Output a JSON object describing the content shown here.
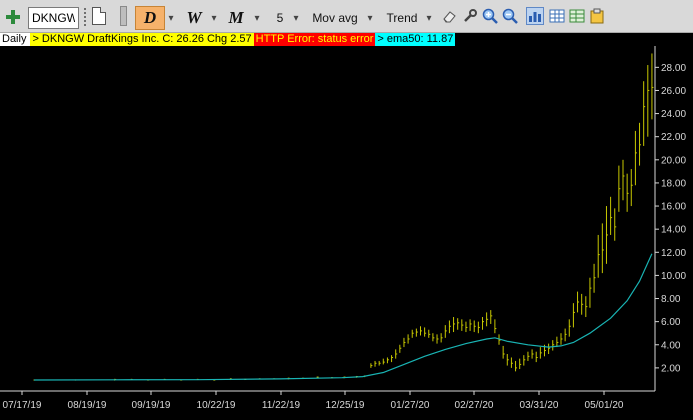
{
  "toolbar": {
    "symbol_value": "DKNGW",
    "period_daily": "D",
    "period_weekly": "W",
    "period_monthly": "M",
    "interval_value": "5",
    "indicator_label": "Mov avg",
    "trend_label": "Trend",
    "dropdown_glyph": "▾"
  },
  "status": {
    "period": "Daily",
    "quote": "> DKNGW  DraftKings Inc.  C: 26.26  Chg 2.57",
    "error": "HTTP Error: status error",
    "ema": "> ema50: 11.87"
  },
  "colors": {
    "background": "#000000",
    "bars": "#c8c800",
    "ema_line": "#19b4b4",
    "axis": "#d8d8d8"
  },
  "chart_data": {
    "type": "line",
    "x_tick_labels": [
      "07/17/19",
      "08/19/19",
      "09/19/19",
      "10/22/19",
      "11/22/19",
      "12/25/19",
      "01/27/20",
      "02/27/20",
      "03/31/20",
      "05/01/20"
    ],
    "y_tick_labels": [
      "2.00",
      "4.00",
      "6.00",
      "8.00",
      "10.00",
      "12.00",
      "14.00",
      "16.00",
      "18.00",
      "20.00",
      "22.00",
      "24.00",
      "26.00",
      "28.00"
    ],
    "ylim": [
      0,
      29.5
    ],
    "series": [
      {
        "type": "bar",
        "values": [
          [
            1,
            0.9,
            1,
            0.95
          ],
          [
            21,
            0.9,
            1,
            0.95
          ],
          [
            40,
            0.9,
            1.05,
            1
          ],
          [
            48,
            0.95,
            1.05,
            1
          ],
          [
            56,
            0.9,
            1,
            0.95
          ],
          [
            64,
            0.95,
            1.05,
            1
          ],
          [
            72,
            0.9,
            1,
            0.95
          ],
          [
            80,
            0.95,
            1.05,
            1
          ],
          [
            88,
            0.9,
            1,
            0.95
          ],
          [
            96,
            0.95,
            1.1,
            1.05
          ],
          [
            103,
            0.95,
            1.05,
            1
          ],
          [
            110,
            1,
            1.1,
            1.05
          ],
          [
            117,
            1,
            1.1,
            1.05
          ],
          [
            124,
            1,
            1.15,
            1.1
          ],
          [
            131,
            1.05,
            1.15,
            1.1
          ],
          [
            138,
            1.1,
            1.25,
            1.2
          ],
          [
            145,
            1.1,
            1.2,
            1.15
          ],
          [
            151,
            1.1,
            1.25,
            1.2
          ],
          [
            157,
            1.15,
            1.3,
            1.25
          ],
          [
            161,
            1.2,
            1.35,
            1.3
          ],
          [
            164,
            2.0,
            2.4,
            2.2
          ],
          [
            166,
            2.1,
            2.6,
            2.4
          ],
          [
            168,
            2.2,
            2.6,
            2.4
          ],
          [
            170,
            2.3,
            2.8,
            2.5
          ],
          [
            172,
            2.4,
            2.9,
            2.7
          ],
          [
            174,
            2.5,
            3.1,
            2.9
          ],
          [
            176,
            2.8,
            3.6,
            3.2
          ],
          [
            178,
            3.3,
            4.0,
            3.7
          ],
          [
            180,
            3.8,
            4.6,
            4.2
          ],
          [
            182,
            4.1,
            4.9,
            4.5
          ],
          [
            184,
            4.6,
            5.3,
            5.0
          ],
          [
            186,
            4.7,
            5.4,
            5.1
          ],
          [
            188,
            4.8,
            5.6,
            5.2
          ],
          [
            190,
            4.7,
            5.5,
            5.0
          ],
          [
            192,
            4.6,
            5.3,
            4.9
          ],
          [
            194,
            4.3,
            5.0,
            4.6
          ],
          [
            196,
            4.1,
            4.9,
            4.5
          ],
          [
            198,
            4.2,
            5.0,
            4.6
          ],
          [
            200,
            4.6,
            5.7,
            5.2
          ],
          [
            202,
            5.0,
            6.1,
            5.6
          ],
          [
            204,
            5.1,
            6.4,
            5.8
          ],
          [
            206,
            5.3,
            6.3,
            5.9
          ],
          [
            208,
            5.2,
            6.2,
            5.7
          ],
          [
            210,
            5.1,
            6.0,
            5.5
          ],
          [
            212,
            5.2,
            6.2,
            5.8
          ],
          [
            214,
            5.1,
            6.1,
            5.6
          ],
          [
            216,
            5.0,
            6.0,
            5.5
          ],
          [
            218,
            5.3,
            6.4,
            6.0
          ],
          [
            220,
            5.6,
            6.8,
            6.2
          ],
          [
            222,
            5.8,
            7.0,
            6.5
          ],
          [
            224,
            5.0,
            6.2,
            5.4
          ],
          [
            226,
            4.0,
            4.9,
            4.4
          ],
          [
            228,
            2.8,
            3.9,
            3.2
          ],
          [
            230,
            2.2,
            3.2,
            2.7
          ],
          [
            232,
            2.0,
            2.9,
            2.4
          ],
          [
            234,
            1.7,
            2.6,
            2.0
          ],
          [
            236,
            1.9,
            2.8,
            2.3
          ],
          [
            238,
            2.2,
            3.1,
            2.7
          ],
          [
            240,
            2.6,
            3.4,
            3.0
          ],
          [
            242,
            2.8,
            3.6,
            3.2
          ],
          [
            244,
            2.5,
            3.4,
            2.9
          ],
          [
            246,
            2.8,
            3.8,
            3.3
          ],
          [
            248,
            3.0,
            4.0,
            3.5
          ],
          [
            250,
            3.2,
            4.1,
            3.7
          ],
          [
            252,
            3.5,
            4.4,
            4.0
          ],
          [
            254,
            3.8,
            4.7,
            4.2
          ],
          [
            256,
            4.0,
            5.0,
            4.5
          ],
          [
            258,
            4.3,
            5.4,
            4.9
          ],
          [
            260,
            4.7,
            6.2,
            5.6
          ],
          [
            262,
            5.5,
            7.6,
            6.8
          ],
          [
            264,
            6.8,
            8.6,
            7.7
          ],
          [
            266,
            6.6,
            8.4,
            7.5
          ],
          [
            268,
            6.4,
            8.2,
            7.3
          ],
          [
            270,
            7.2,
            9.8,
            8.9
          ],
          [
            272,
            8.5,
            11.0,
            9.8
          ],
          [
            274,
            9.8,
            13.5,
            11.8
          ],
          [
            276,
            10.2,
            14.5,
            12.2
          ],
          [
            278,
            11.0,
            16.0,
            13.5
          ],
          [
            280,
            13.5,
            16.8,
            15.0
          ],
          [
            282,
            13.0,
            15.8,
            14.2
          ],
          [
            284,
            15.5,
            19.5,
            17.5
          ],
          [
            286,
            16.5,
            20.0,
            18.6
          ],
          [
            288,
            15.5,
            18.8,
            17.1
          ],
          [
            290,
            16.0,
            19.2,
            17.8
          ],
          [
            292,
            17.8,
            22.5,
            20.6
          ],
          [
            294,
            19.5,
            23.2,
            21.3
          ],
          [
            296,
            21.2,
            26.8,
            24.6
          ],
          [
            298,
            22.0,
            28.2,
            26.0
          ],
          [
            300,
            23.5,
            29.2,
            26.26
          ]
        ]
      },
      {
        "type": "line",
        "name": "ema50",
        "values": [
          [
            1,
            0.95
          ],
          [
            40,
            0.97
          ],
          [
            80,
            0.98
          ],
          [
            120,
            1.05
          ],
          [
            150,
            1.15
          ],
          [
            160,
            1.25
          ],
          [
            170,
            1.6
          ],
          [
            180,
            2.3
          ],
          [
            190,
            3.0
          ],
          [
            200,
            3.6
          ],
          [
            210,
            4.1
          ],
          [
            220,
            4.5
          ],
          [
            224,
            4.6
          ],
          [
            230,
            4.3
          ],
          [
            240,
            4.0
          ],
          [
            250,
            3.8
          ],
          [
            256,
            3.9
          ],
          [
            262,
            4.2
          ],
          [
            270,
            5.0
          ],
          [
            280,
            6.3
          ],
          [
            288,
            7.8
          ],
          [
            294,
            9.5
          ],
          [
            300,
            11.87
          ]
        ]
      }
    ]
  }
}
